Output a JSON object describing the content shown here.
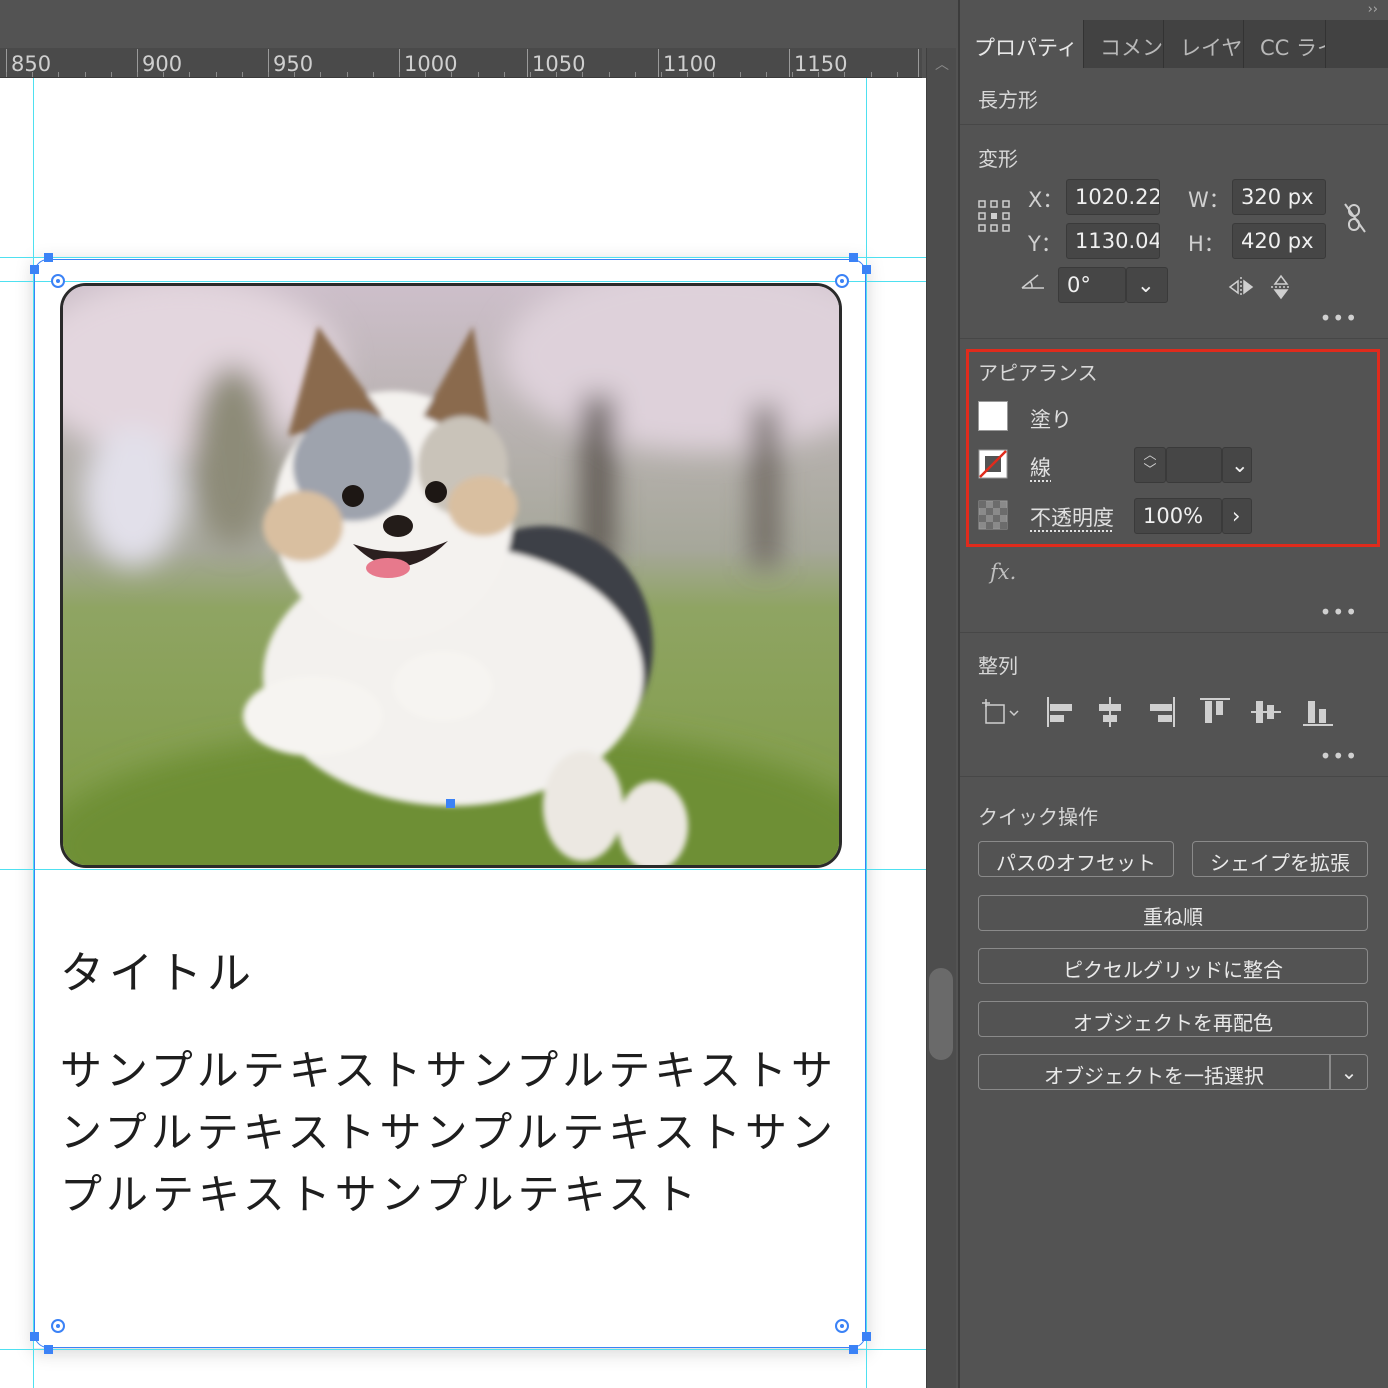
{
  "ruler": {
    "ticks": [
      "850",
      "900",
      "950",
      "1000",
      "1050",
      "1100",
      "1150"
    ]
  },
  "card": {
    "title": "タイトル",
    "body": "サンプルテキストサンプルテキストサンプルテキストサンプルテキストサンプルテキストサンプルテキスト"
  },
  "panel": {
    "tabs": [
      "プロパティ",
      "コメント",
      "レイヤー",
      "CC ライブラリ"
    ],
    "object_type": "長方形",
    "transform": {
      "title": "変形",
      "x_label": "X：",
      "x_value": "1020.22",
      "y_label": "Y：",
      "y_value": "1130.04",
      "w_label": "W：",
      "w_value": "320 px",
      "h_label": "H：",
      "h_value": "420 px",
      "angle_value": "0°"
    },
    "appearance": {
      "title": "アピアランス",
      "fill_label": "塗り",
      "stroke_label": "線",
      "stroke_value": "",
      "opacity_label": "不透明度",
      "opacity_value": "100%",
      "fx_label": "fx."
    },
    "align": {
      "title": "整列"
    },
    "quick_actions": {
      "title": "クイック操作",
      "offset_path": "パスのオフセット",
      "expand_shape": "シェイプを拡張",
      "arrange": "重ね順",
      "pixel_grid": "ピクセルグリッドに整合",
      "recolor": "オブジェクトを再配色",
      "select_same": "オブジェクトを一括選択"
    }
  },
  "colors": {
    "selection": "#3b82f6",
    "guide": "#4ee0f0",
    "highlight": "#e02b1c",
    "panel_bg": "#535353"
  }
}
